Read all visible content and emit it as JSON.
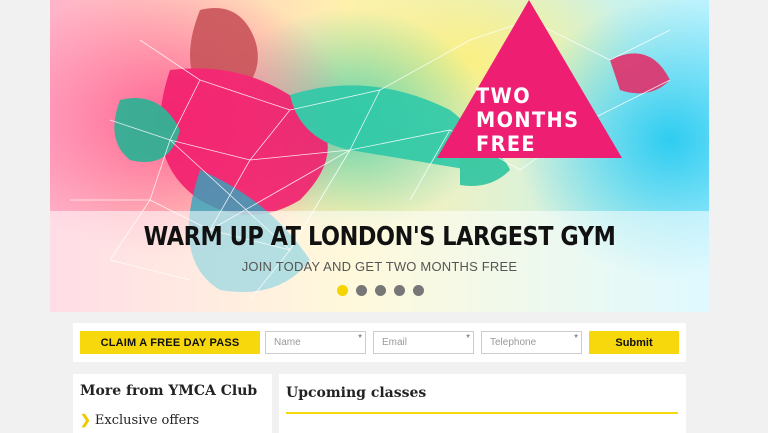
{
  "hero": {
    "promo_line1": "TWO",
    "promo_line2": "MONTHS",
    "promo_line3": "FREE",
    "title": "WARM UP AT LONDON'S LARGEST GYM",
    "subtitle": "JOIN TODAY AND GET TWO MONTHS FREE",
    "slides": 5,
    "active_slide": 1
  },
  "form": {
    "claim_label": "CLAIM A FREE DAY PASS",
    "name_placeholder": "Name",
    "email_placeholder": "Email",
    "telephone_placeholder": "Telephone",
    "required_mark": "*",
    "submit_label": "Submit"
  },
  "sidebar": {
    "title": "More from YMCA Club",
    "items": [
      {
        "label": "Exclusive offers"
      }
    ]
  },
  "classes": {
    "title": "Upcoming classes"
  },
  "colors": {
    "accent_yellow": "#f6d80d",
    "promo_pink": "#ee1f73",
    "page_bg": "#f1f1f1"
  }
}
